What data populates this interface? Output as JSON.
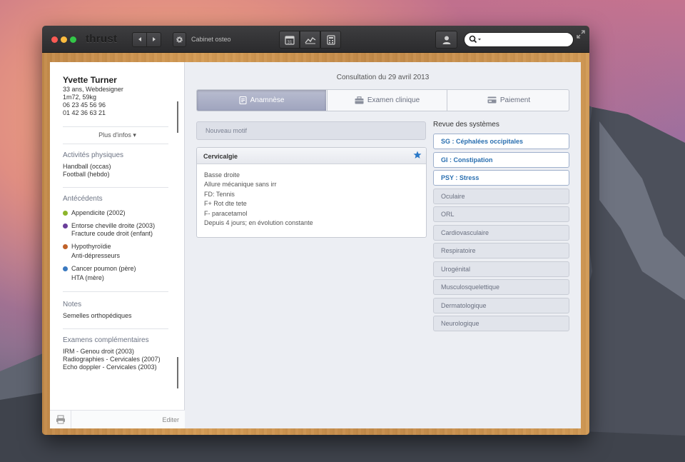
{
  "app": {
    "logo": "thrust",
    "cabinet": "Cabinet osteo",
    "search_placeholder": ""
  },
  "patient": {
    "name": "Yvette Turner",
    "info": [
      "33 ans, Webdesigner",
      "1m72, 59kg",
      "06 23 45 56 96",
      "01 42 36 63 21"
    ],
    "more_label": "Plus d'infos ▾"
  },
  "activities": {
    "title": "Activités physiques",
    "items": [
      "Handball (occas)",
      "Football (hebdo)"
    ]
  },
  "history": {
    "title": "Antécédents",
    "groups": [
      {
        "color": "#8db52c",
        "lines": [
          "Appendicite (2002)"
        ]
      },
      {
        "color": "#6a3e9a",
        "lines": [
          "Entorse cheville droite (2003)",
          "Fracture coude droit (enfant)"
        ]
      },
      {
        "color": "#c0622a",
        "lines": [
          "Hypothyroïdie",
          "Anti-dépresseurs"
        ]
      },
      {
        "color": "#3a79c0",
        "lines": [
          "Cancer poumon (père)",
          "HTA (mère)"
        ]
      }
    ]
  },
  "notes": {
    "title": "Notes",
    "items": [
      "Semelles orthopédiques"
    ]
  },
  "exams": {
    "title": "Examens complémentaires",
    "items": [
      "IRM - Genou droit (2003)",
      "Radiographies - Cervicales (2007)",
      "Echo doppler - Cervicales (2003)"
    ]
  },
  "sidebar_footer": {
    "edit_label": "Editer"
  },
  "consultation": {
    "title": "Consultation du 29 avril 2013",
    "tabs": [
      {
        "label": "Anamnèse",
        "active": true
      },
      {
        "label": "Examen clinique",
        "active": false
      },
      {
        "label": "Paiement",
        "active": false
      }
    ],
    "new_motif_label": "Nouveau motif",
    "card": {
      "title": "Cervicalgie",
      "lines": [
        "Basse droite",
        "Allure mécanique sans irr",
        "FD: Tennis",
        "F+ Rot dte tete",
        "F- paracetamol",
        "Depuis 4 jours; en évolution constante"
      ]
    }
  },
  "review": {
    "title": "Revue des systèmes",
    "items": [
      {
        "label": "SG : Céphalées occipitales",
        "active": true
      },
      {
        "label": "GI : Constipation",
        "active": true
      },
      {
        "label": "PSY : Stress",
        "active": true
      },
      {
        "label": "Oculaire",
        "active": false
      },
      {
        "label": "ORL",
        "active": false
      },
      {
        "label": "Cardiovasculaire",
        "active": false
      },
      {
        "label": "Respiratoire",
        "active": false
      },
      {
        "label": "Urogénital",
        "active": false
      },
      {
        "label": "Musculosquelettique",
        "active": false
      },
      {
        "label": "Dermatologique",
        "active": false
      },
      {
        "label": "Neurologique",
        "active": false
      }
    ]
  },
  "colors": {
    "accent": "#2a6fb0",
    "tab_active": "#a4a9c2",
    "star": "#2a78c8"
  }
}
